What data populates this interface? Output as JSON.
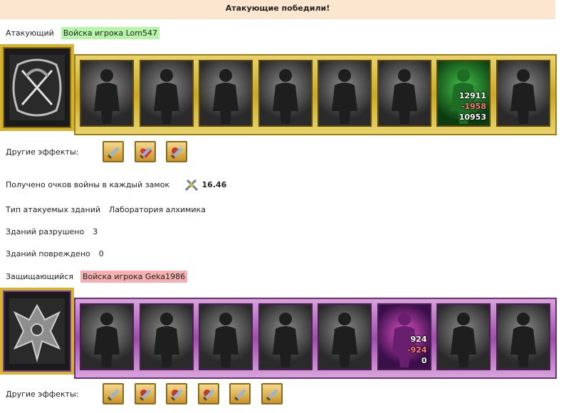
{
  "result_banner": "Атакующие победили!",
  "attacker": {
    "label": "Атакующий",
    "army_name": "Войска игрока Lom547",
    "units": [
      {
        "name": "dwarf-axeman-icon",
        "alive": false
      },
      {
        "name": "armored-knight-icon",
        "alive": false
      },
      {
        "name": "spearman-icon",
        "alive": false
      },
      {
        "name": "griffin-icon",
        "alive": false
      },
      {
        "name": "archer-icon",
        "alive": false
      },
      {
        "name": "priestess-icon",
        "alive": false
      },
      {
        "name": "druid-icon",
        "alive": true,
        "stats": {
          "count": "12911",
          "loss": "-1958",
          "power": "10953"
        }
      },
      {
        "name": "wizard-icon",
        "alive": false
      }
    ],
    "effects_label": "Другие эффекты:",
    "effects": [
      "sword-icon",
      "heart-sword-icon",
      "fist-sword-icon"
    ]
  },
  "war_points": {
    "label": "Получено очков войны в каждый замок",
    "value": "16.46",
    "icon": "crossed-swords-icon"
  },
  "buildings": {
    "type_label": "Тип атакуемых зданий",
    "type_value": "Лаборатория алхимика",
    "destroyed_label": "Зданий разрушено",
    "destroyed_value": "3",
    "damaged_label": "Зданий повреждено",
    "damaged_value": "0"
  },
  "defender": {
    "label": "Защищающийся",
    "army_name": "Войска игрока Geka1986",
    "units": [
      {
        "name": "golem-icon",
        "alive": false
      },
      {
        "name": "samurai-icon",
        "alive": false
      },
      {
        "name": "warlord-icon",
        "alive": false
      },
      {
        "name": "demon-bird-icon",
        "alive": false
      },
      {
        "name": "dark-archer-icon",
        "alive": false
      },
      {
        "name": "sorcerer-icon",
        "alive": true,
        "stats": {
          "count": "924",
          "loss": "-924",
          "power": "0"
        }
      },
      {
        "name": "reaper-icon",
        "alive": false
      },
      {
        "name": "spider-rider-icon",
        "alive": false
      }
    ],
    "effects_label": "Другие эффекты:",
    "effects": [
      "sword-icon",
      "fist-sword-icon",
      "fist-sword-icon",
      "fist-sword-icon",
      "sword-icon",
      "sword-icon"
    ]
  },
  "colors": {
    "banner": "#fde6cf",
    "attacker_tag": "#b6f5a8",
    "defender_tag": "#f5b1b1",
    "attacker_frame": "#d4b431",
    "defender_frame": "#9b4fa6"
  }
}
